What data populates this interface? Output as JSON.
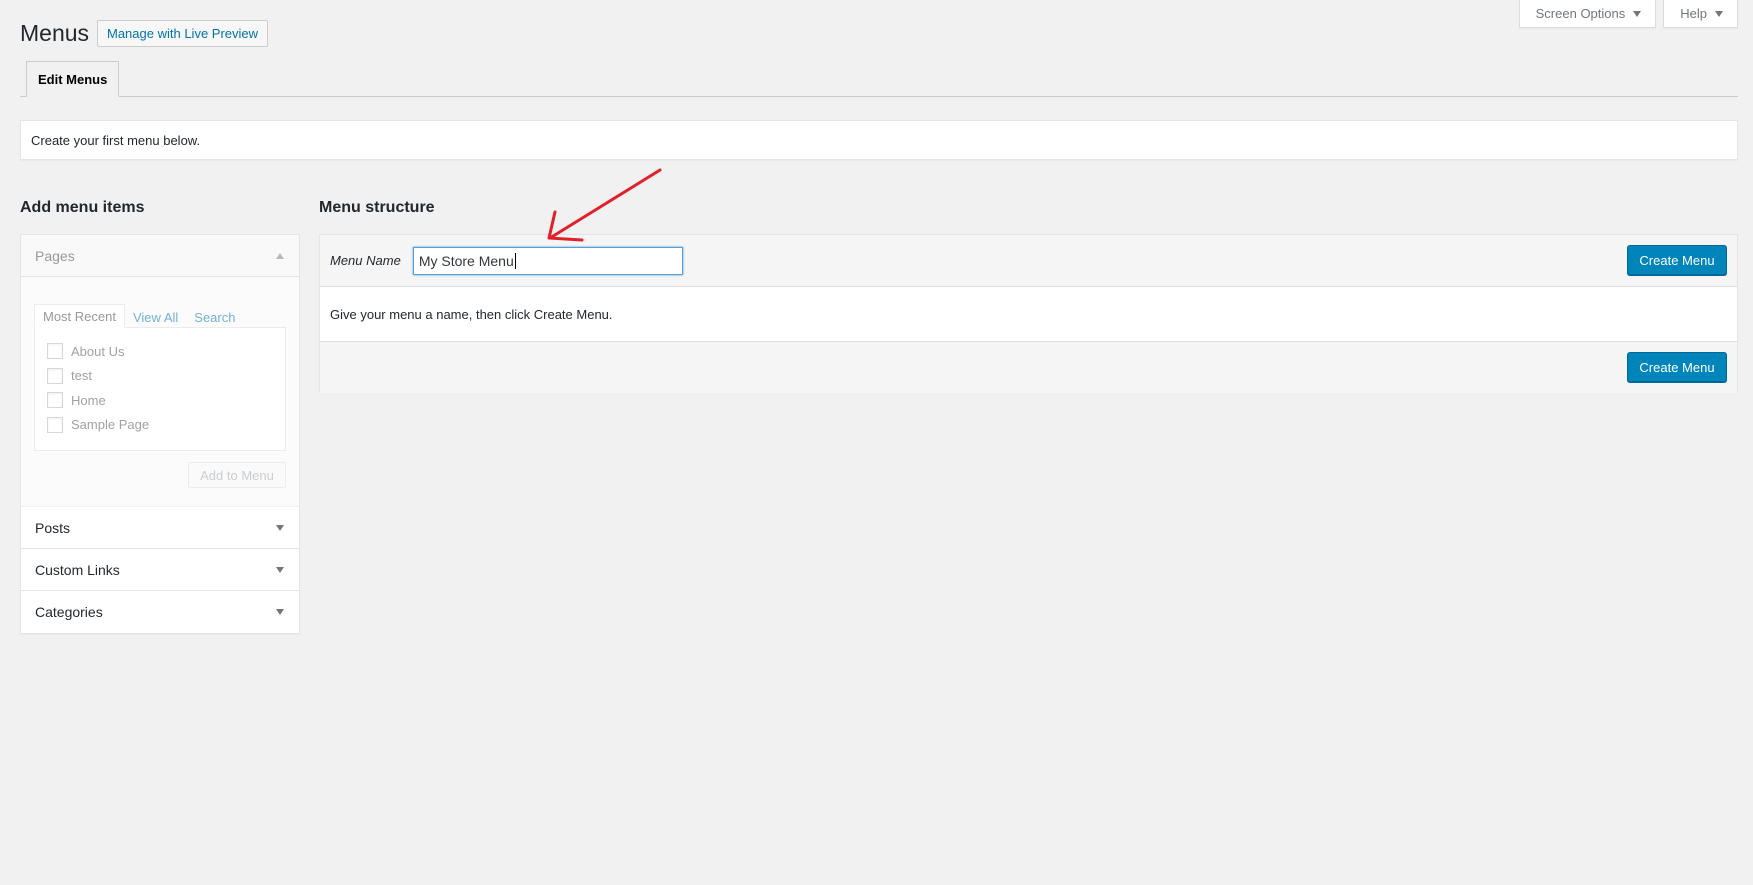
{
  "header": {
    "title": "Menus",
    "live_preview_button": "Manage with Live Preview",
    "screen_options": "Screen Options",
    "help": "Help"
  },
  "nav": {
    "active_tab": "Edit Menus"
  },
  "notice": {
    "text": "Create your first menu below."
  },
  "left": {
    "title": "Add menu items",
    "sections": {
      "pages": "Pages",
      "posts": "Posts",
      "custom_links": "Custom Links",
      "categories": "Categories"
    },
    "tabs": [
      "Most Recent",
      "View All",
      "Search"
    ],
    "pages_list": [
      "About Us",
      "test",
      "Home",
      "Sample Page"
    ],
    "add_button": "Add to Menu"
  },
  "right": {
    "title": "Menu structure",
    "menu_name_label": "Menu Name",
    "menu_name_value": "My Store Menu",
    "instruction": "Give your menu a name, then click Create Menu.",
    "create_button": "Create Menu"
  },
  "colors": {
    "primary": "#0085ba",
    "link": "#0073aa",
    "annotation": "#e0202a"
  }
}
